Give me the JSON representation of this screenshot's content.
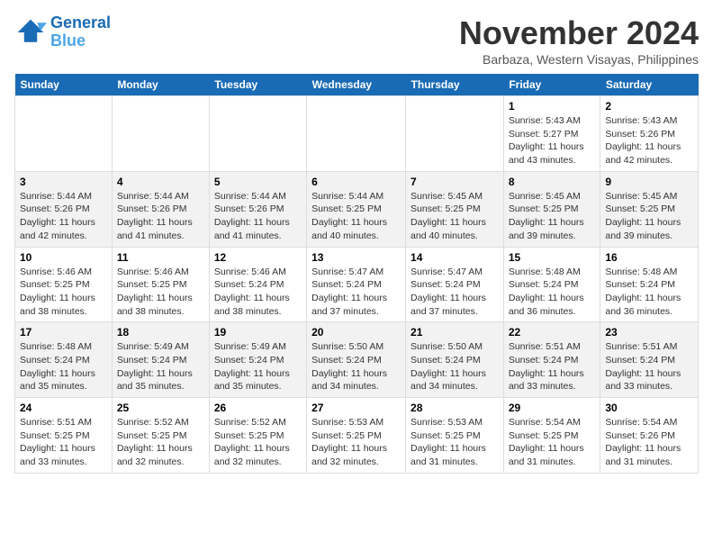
{
  "header": {
    "logo_line1": "General",
    "logo_line2": "Blue",
    "title": "November 2024",
    "location": "Barbaza, Western Visayas, Philippines"
  },
  "weekdays": [
    "Sunday",
    "Monday",
    "Tuesday",
    "Wednesday",
    "Thursday",
    "Friday",
    "Saturday"
  ],
  "weeks": [
    [
      {
        "day": "",
        "info": ""
      },
      {
        "day": "",
        "info": ""
      },
      {
        "day": "",
        "info": ""
      },
      {
        "day": "",
        "info": ""
      },
      {
        "day": "",
        "info": ""
      },
      {
        "day": "1",
        "info": "Sunrise: 5:43 AM\nSunset: 5:27 PM\nDaylight: 11 hours and 43 minutes."
      },
      {
        "day": "2",
        "info": "Sunrise: 5:43 AM\nSunset: 5:26 PM\nDaylight: 11 hours and 42 minutes."
      }
    ],
    [
      {
        "day": "3",
        "info": "Sunrise: 5:44 AM\nSunset: 5:26 PM\nDaylight: 11 hours and 42 minutes."
      },
      {
        "day": "4",
        "info": "Sunrise: 5:44 AM\nSunset: 5:26 PM\nDaylight: 11 hours and 41 minutes."
      },
      {
        "day": "5",
        "info": "Sunrise: 5:44 AM\nSunset: 5:26 PM\nDaylight: 11 hours and 41 minutes."
      },
      {
        "day": "6",
        "info": "Sunrise: 5:44 AM\nSunset: 5:25 PM\nDaylight: 11 hours and 40 minutes."
      },
      {
        "day": "7",
        "info": "Sunrise: 5:45 AM\nSunset: 5:25 PM\nDaylight: 11 hours and 40 minutes."
      },
      {
        "day": "8",
        "info": "Sunrise: 5:45 AM\nSunset: 5:25 PM\nDaylight: 11 hours and 39 minutes."
      },
      {
        "day": "9",
        "info": "Sunrise: 5:45 AM\nSunset: 5:25 PM\nDaylight: 11 hours and 39 minutes."
      }
    ],
    [
      {
        "day": "10",
        "info": "Sunrise: 5:46 AM\nSunset: 5:25 PM\nDaylight: 11 hours and 38 minutes."
      },
      {
        "day": "11",
        "info": "Sunrise: 5:46 AM\nSunset: 5:25 PM\nDaylight: 11 hours and 38 minutes."
      },
      {
        "day": "12",
        "info": "Sunrise: 5:46 AM\nSunset: 5:24 PM\nDaylight: 11 hours and 38 minutes."
      },
      {
        "day": "13",
        "info": "Sunrise: 5:47 AM\nSunset: 5:24 PM\nDaylight: 11 hours and 37 minutes."
      },
      {
        "day": "14",
        "info": "Sunrise: 5:47 AM\nSunset: 5:24 PM\nDaylight: 11 hours and 37 minutes."
      },
      {
        "day": "15",
        "info": "Sunrise: 5:48 AM\nSunset: 5:24 PM\nDaylight: 11 hours and 36 minutes."
      },
      {
        "day": "16",
        "info": "Sunrise: 5:48 AM\nSunset: 5:24 PM\nDaylight: 11 hours and 36 minutes."
      }
    ],
    [
      {
        "day": "17",
        "info": "Sunrise: 5:48 AM\nSunset: 5:24 PM\nDaylight: 11 hours and 35 minutes."
      },
      {
        "day": "18",
        "info": "Sunrise: 5:49 AM\nSunset: 5:24 PM\nDaylight: 11 hours and 35 minutes."
      },
      {
        "day": "19",
        "info": "Sunrise: 5:49 AM\nSunset: 5:24 PM\nDaylight: 11 hours and 35 minutes."
      },
      {
        "day": "20",
        "info": "Sunrise: 5:50 AM\nSunset: 5:24 PM\nDaylight: 11 hours and 34 minutes."
      },
      {
        "day": "21",
        "info": "Sunrise: 5:50 AM\nSunset: 5:24 PM\nDaylight: 11 hours and 34 minutes."
      },
      {
        "day": "22",
        "info": "Sunrise: 5:51 AM\nSunset: 5:24 PM\nDaylight: 11 hours and 33 minutes."
      },
      {
        "day": "23",
        "info": "Sunrise: 5:51 AM\nSunset: 5:24 PM\nDaylight: 11 hours and 33 minutes."
      }
    ],
    [
      {
        "day": "24",
        "info": "Sunrise: 5:51 AM\nSunset: 5:25 PM\nDaylight: 11 hours and 33 minutes."
      },
      {
        "day": "25",
        "info": "Sunrise: 5:52 AM\nSunset: 5:25 PM\nDaylight: 11 hours and 32 minutes."
      },
      {
        "day": "26",
        "info": "Sunrise: 5:52 AM\nSunset: 5:25 PM\nDaylight: 11 hours and 32 minutes."
      },
      {
        "day": "27",
        "info": "Sunrise: 5:53 AM\nSunset: 5:25 PM\nDaylight: 11 hours and 32 minutes."
      },
      {
        "day": "28",
        "info": "Sunrise: 5:53 AM\nSunset: 5:25 PM\nDaylight: 11 hours and 31 minutes."
      },
      {
        "day": "29",
        "info": "Sunrise: 5:54 AM\nSunset: 5:25 PM\nDaylight: 11 hours and 31 minutes."
      },
      {
        "day": "30",
        "info": "Sunrise: 5:54 AM\nSunset: 5:26 PM\nDaylight: 11 hours and 31 minutes."
      }
    ]
  ]
}
